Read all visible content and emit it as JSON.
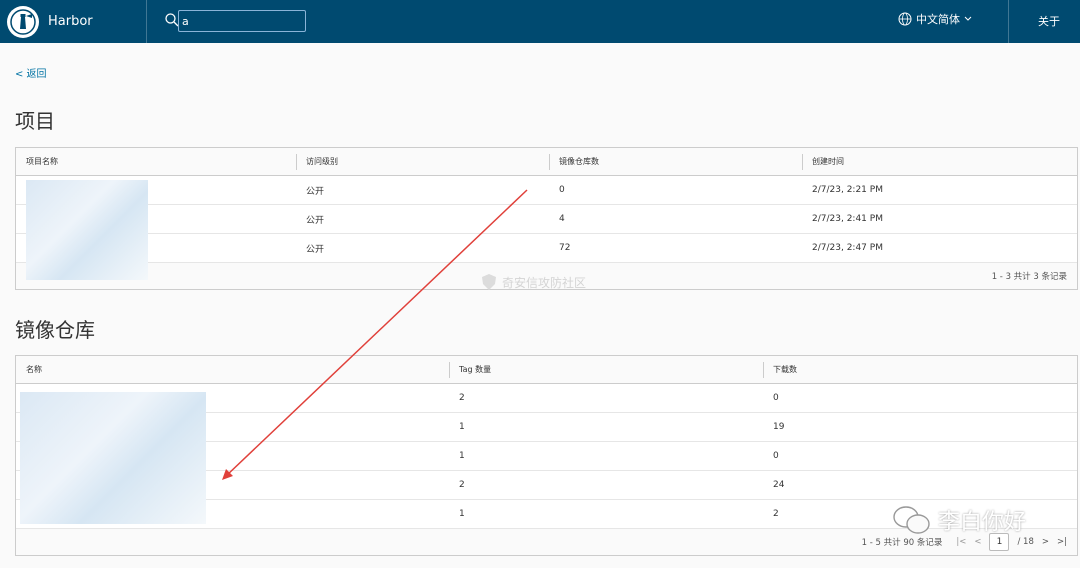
{
  "header": {
    "brand": "Harbor",
    "search_value": "a",
    "language": "中文简体",
    "about": "关于"
  },
  "back_link": "< 返回",
  "projects": {
    "title": "项目",
    "columns": [
      "项目名称",
      "访问级别",
      "镜像仓库数",
      "创建时间"
    ],
    "rows": [
      {
        "access": "公开",
        "repos": "0",
        "created": "2/7/23, 2:21 PM"
      },
      {
        "access": "公开",
        "repos": "4",
        "created": "2/7/23, 2:41 PM"
      },
      {
        "access": "公开",
        "repos": "72",
        "created": "2/7/23, 2:47 PM"
      }
    ],
    "footer": "1 - 3 共计 3 条记录"
  },
  "repositories": {
    "title": "镜像仓库",
    "columns": [
      "名称",
      "Tag 数量",
      "下载数"
    ],
    "rows": [
      {
        "tags": "2",
        "downloads": "0"
      },
      {
        "tags": "1",
        "downloads": "19"
      },
      {
        "tags": "1",
        "downloads": "0"
      },
      {
        "tags": "2",
        "downloads": "24"
      },
      {
        "tags": "1",
        "downloads": "2"
      }
    ],
    "footer": "1 - 5 共计 90 条记录",
    "page_current": "1",
    "page_total": "/ 18"
  },
  "watermark": "奇安信攻防社区",
  "wechat_mark": "李白你好",
  "colors": {
    "header_bg": "#004a70",
    "link": "#0072a3",
    "arrow": "#e0403a"
  }
}
